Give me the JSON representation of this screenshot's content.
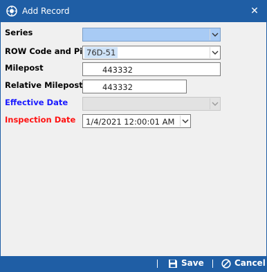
{
  "window": {
    "title": "Add Record",
    "title_icon": "app-icon",
    "close_glyph": "✕"
  },
  "form": {
    "series": {
      "label": "Series",
      "value": ""
    },
    "row_code": {
      "label": "ROW Code and Pipe",
      "chip": "76D-51",
      "value": ""
    },
    "milepost": {
      "label": "Milepost",
      "value": "443332"
    },
    "relative_milepost": {
      "label": "Relative Milepost",
      "value": "443332"
    },
    "effective_date": {
      "label": "Effective Date",
      "value": ""
    },
    "inspection_date": {
      "label": "Inspection Date",
      "value": "1/4/2021 12:00:01 AM"
    }
  },
  "footer": {
    "save_label": "Save",
    "cancel_label": "Cancel"
  },
  "colors": {
    "title_bar": "#1f5ea5",
    "series_highlight": "#a8cbf5",
    "effective_label": "#1a1aff",
    "inspection_label": "#ff1111"
  }
}
